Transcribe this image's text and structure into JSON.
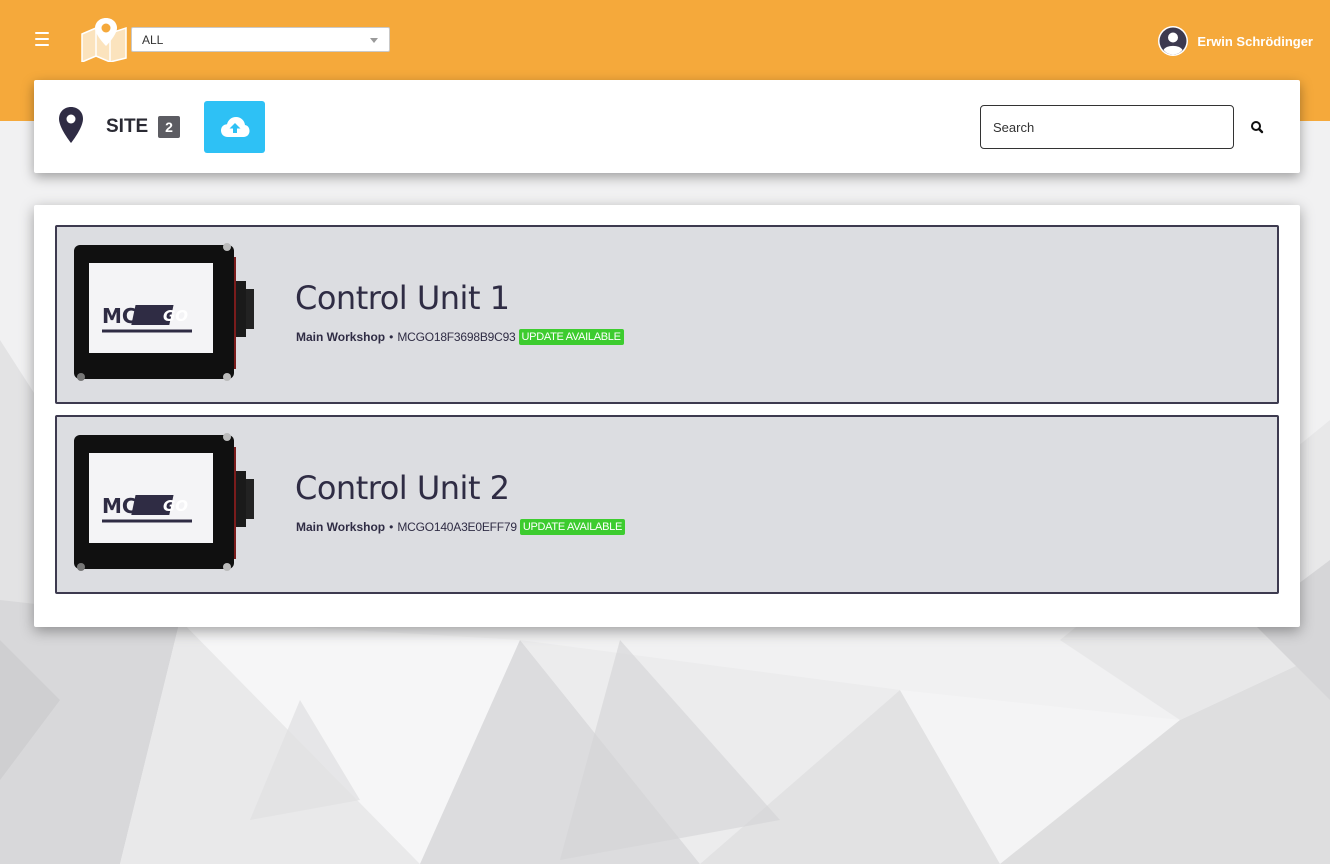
{
  "header": {
    "site_filter": {
      "selected": "ALL"
    },
    "user": {
      "name": "Erwin Schrödinger"
    }
  },
  "site": {
    "title": "SITE",
    "count": "2",
    "search_placeholder": "Search"
  },
  "devices": [
    {
      "name": "Control Unit 1",
      "location": "Main Workshop",
      "separator": "•",
      "serial": "MCGO18F3698B9C93",
      "badge": "UPDATE AVAILABLE",
      "device_logo": "MCO GO"
    },
    {
      "name": "Control Unit 2",
      "location": "Main Workshop",
      "separator": "•",
      "serial": "MCGO140A3E0EFF79",
      "badge": "UPDATE AVAILABLE",
      "device_logo": "MCO GO"
    }
  ],
  "colors": {
    "header_bg": "#f5a93b",
    "upload_button": "#2ec1f5",
    "badge": "#3dcc2f",
    "row_bg": "#dcdde1",
    "row_border": "#3d3a4f"
  },
  "icons": {
    "menu": "hamburger-icon",
    "logo": "map-pin-logo",
    "user": "user-circle-icon",
    "location": "map-pin-icon",
    "upload": "cloud-upload-icon",
    "search": "search-icon"
  }
}
